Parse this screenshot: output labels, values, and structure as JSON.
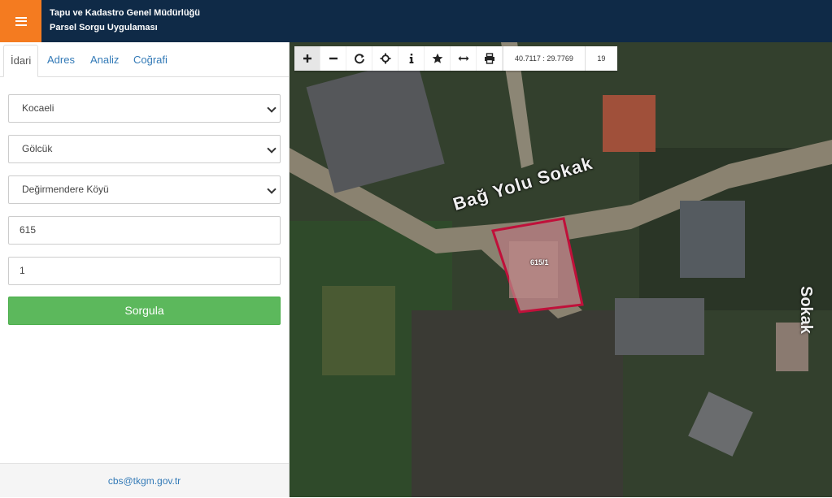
{
  "header": {
    "title_line1": "Tapu ve Kadastro Genel Müdürlüğü",
    "title_line2": "Parsel Sorgu Uygulaması"
  },
  "tabs": [
    {
      "label": "İdari",
      "active": true
    },
    {
      "label": "Adres",
      "active": false
    },
    {
      "label": "Analiz",
      "active": false
    },
    {
      "label": "Coğrafi",
      "active": false
    }
  ],
  "form": {
    "il": "Kocaeli",
    "ilce": "Gölcük",
    "mahalle": "Değirmendere Köyü",
    "ada": "615",
    "parsel": "1",
    "submit_label": "Sorgula"
  },
  "footer": {
    "email": "cbs@tkgm.gov.tr"
  },
  "map": {
    "coordinates": "40.7117 : 29.7769",
    "zoom_level": "19",
    "road_label": "Bağ Yolu Sokak",
    "parcel_label": "615/1",
    "side_label": "Sokak",
    "tools": [
      "zoom-in-icon",
      "zoom-out-icon",
      "refresh-icon",
      "locate-icon",
      "info-icon",
      "star-icon",
      "measure-icon",
      "print-icon"
    ]
  },
  "colors": {
    "header_bg": "#0f2a47",
    "menu_accent": "#f47b20",
    "button_green": "#5cb85c",
    "link_blue": "#337ab7",
    "parcel_outline": "#c0103a"
  }
}
